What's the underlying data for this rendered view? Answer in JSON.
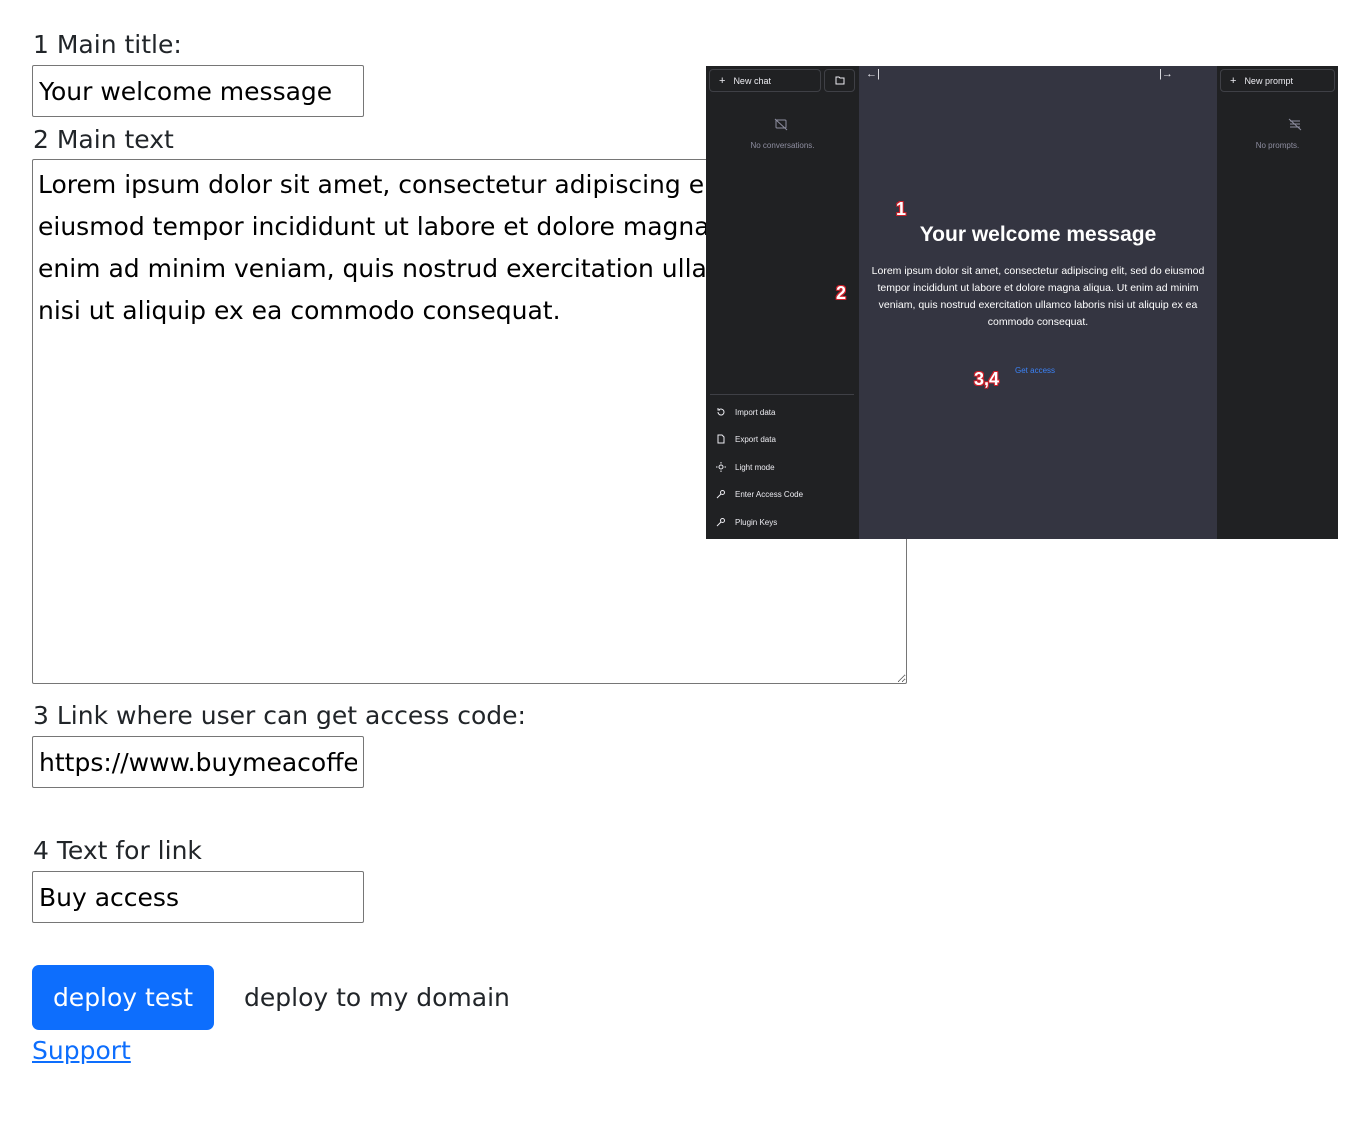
{
  "form": {
    "main_title_label": "1 Main title:",
    "main_title_value": "Your welcome message",
    "main_text_label": "2 Main text",
    "main_text_value": "Lorem ipsum dolor sit amet, consectetur adipiscing elit, sed do eiusmod tempor incididunt ut labore et dolore magna aliqua. Ut enim ad minim veniam, quis nostrud exercitation ullamco laboris nisi ut aliquip ex ea commodo consequat.",
    "link_label": "3 Link where user can get access code:",
    "link_value": "https://www.buymeacoffee.com",
    "link_text_label": "4 Text for link",
    "link_text_value": "Buy access",
    "deploy_test_label": "deploy test",
    "deploy_domain_label": "deploy to my domain",
    "support_label": "Support"
  },
  "preview": {
    "new_chat": "New chat",
    "no_conversations": "No conversations.",
    "new_prompt": "New prompt",
    "no_prompts": "No prompts.",
    "title": "Your welcome message",
    "text": "Lorem ipsum dolor sit amet, consectetur adipiscing elit, sed do eiusmod tempor incididunt ut labore et dolore magna aliqua. Ut enim ad minim veniam, quis nostrud exercitation ullamco laboris nisi ut aliquip ex ea commodo consequat.",
    "get_access": "Get access",
    "menu": [
      "Import data",
      "Export data",
      "Light mode",
      "Enter Access Code",
      "Plugin Keys"
    ],
    "markers": [
      "1",
      "2",
      "3,4"
    ]
  },
  "colors": {
    "primary": "#0d6efd",
    "sidebar": "#202123",
    "chat_bg": "#343541",
    "marker": "#d0202a"
  }
}
